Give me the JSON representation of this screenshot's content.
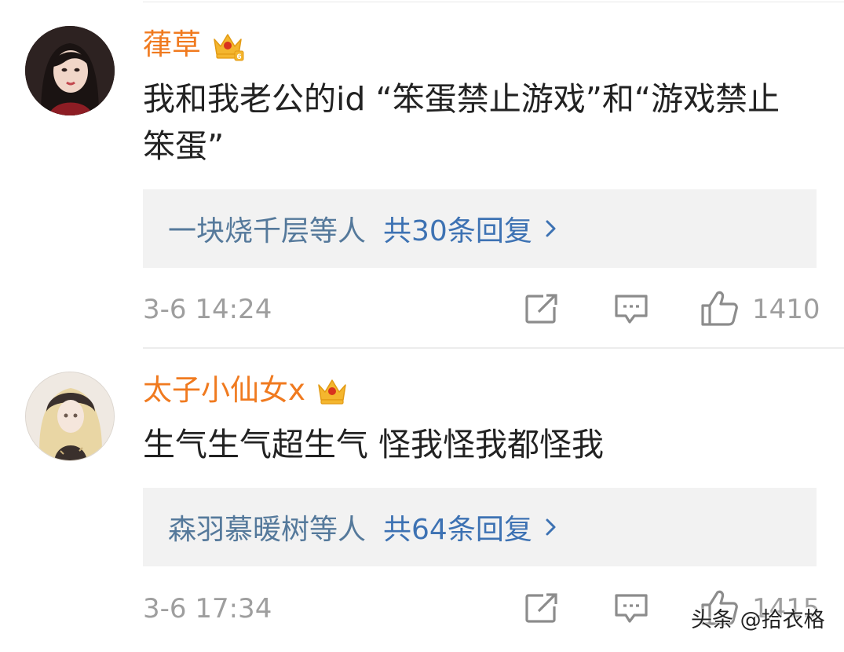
{
  "comments": [
    {
      "username": "葎草",
      "text": "我和我老公的id “笨蛋禁止游戏”和“游戏禁止笨蛋”",
      "replies": {
        "names": "一块烧千层等人",
        "count": "共30条回复"
      },
      "time": "3-6 14:24",
      "likes": "1410",
      "badge_icon": "crown-vip-icon"
    },
    {
      "username": "太子小仙女x",
      "text": "生气生气超生气 怪我怪我都怪我",
      "replies": {
        "names": "森羽慕暖树等人",
        "count": "共64条回复"
      },
      "time": "3-6 17:34",
      "likes": "1415",
      "badge_icon": "crown-vip-icon"
    }
  ],
  "watermark": "头条 @拾衣格",
  "colors": {
    "username": "#f07a1f",
    "reply_names": "#55799b",
    "reply_count": "#3d72b3",
    "reply_box_bg": "#f2f2f2",
    "meta_gray": "#9e9e9e",
    "crown_gold": "#f4b62e",
    "crown_red": "#d8321e"
  }
}
